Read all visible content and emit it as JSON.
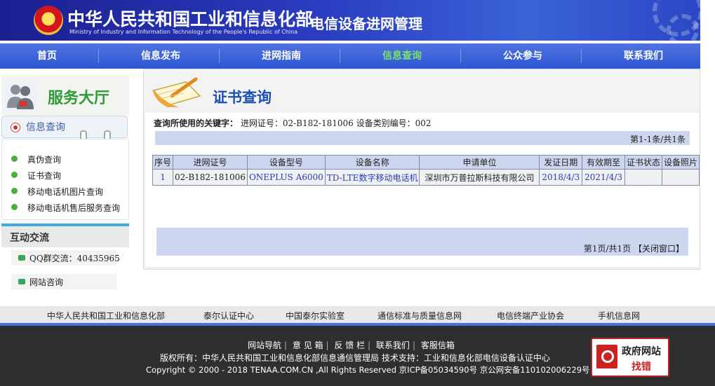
{
  "header": {
    "ministry_cn": "中华人民共和国工业和信息化部",
    "ministry_en": "Ministry of Industry and Information Technology of the People's Republic of China",
    "system_title": "电信设备进网管理"
  },
  "nav": {
    "items": [
      {
        "label": "首页"
      },
      {
        "label": "信息发布"
      },
      {
        "label": "进网指南"
      },
      {
        "label": "信息查询"
      },
      {
        "label": "公众参与"
      },
      {
        "label": "联系我们"
      }
    ],
    "active_index": 3
  },
  "sidebar": {
    "service_title": "服务大厅",
    "info_query_label": "信息查询",
    "links": [
      {
        "label": "真伪查询"
      },
      {
        "label": "证书查询"
      },
      {
        "label": "移动电话机图片查询"
      },
      {
        "label": "移动电话机售后服务查询"
      }
    ],
    "interact_title": "互动交流",
    "qq_label": "QQ群交流：40435965",
    "consult_label": "网站咨询"
  },
  "main": {
    "title": "证书查询",
    "keyword_label": "查询所使用的关键字：",
    "keyword_value": "进网证号：02-B182-181006 设备类别编号：002",
    "count_text": "第1-1条/共1条",
    "table": {
      "headers": [
        "序号",
        "进网证号",
        "设备型号",
        "设备名称",
        "申请单位",
        "发证日期",
        "有效期至",
        "证书状态",
        "设备照片"
      ],
      "rows": [
        [
          "1",
          "02-B182-181006",
          "ONEPLUS A6000",
          "TD-LTE数字移动电话机",
          "深圳市万普拉斯科技有限公司",
          "2018/4/3",
          "2021/4/3",
          "",
          ""
        ]
      ]
    },
    "pager_text": "第1页/共1页",
    "close_window": "【关闭窗口】"
  },
  "partners": [
    "中华人民共和国工业和信息化部",
    "泰尔认证中心",
    "中国泰尔实验室",
    "通信标准与质量信息网",
    "电信终端产业协会",
    "手机信息网"
  ],
  "footer": {
    "links": [
      "网站导航",
      "意 见 箱",
      "反 馈 栏",
      "联系我们",
      "客服信箱"
    ],
    "copyright_line1": "版权所有：中华人民共和国工业和信息化部信息通信管理局   技术支持：工业和信息化部电信设备认证中心",
    "copyright_line2": "Copyright © 2000 - 2018 TENAA.COM.CN ,All Rights Reserved   京ICP备05034590号 京公网安备110102006229号",
    "gov_badge_line1": "政府网站",
    "gov_badge_line2": "找错"
  },
  "colors": {
    "nav_active": "#7ce06b",
    "title_blue": "#1a4fb5",
    "service_green": "#2f9a37",
    "link_blue": "#2b3bb8",
    "table_header_bg": "#cdd6ef"
  }
}
